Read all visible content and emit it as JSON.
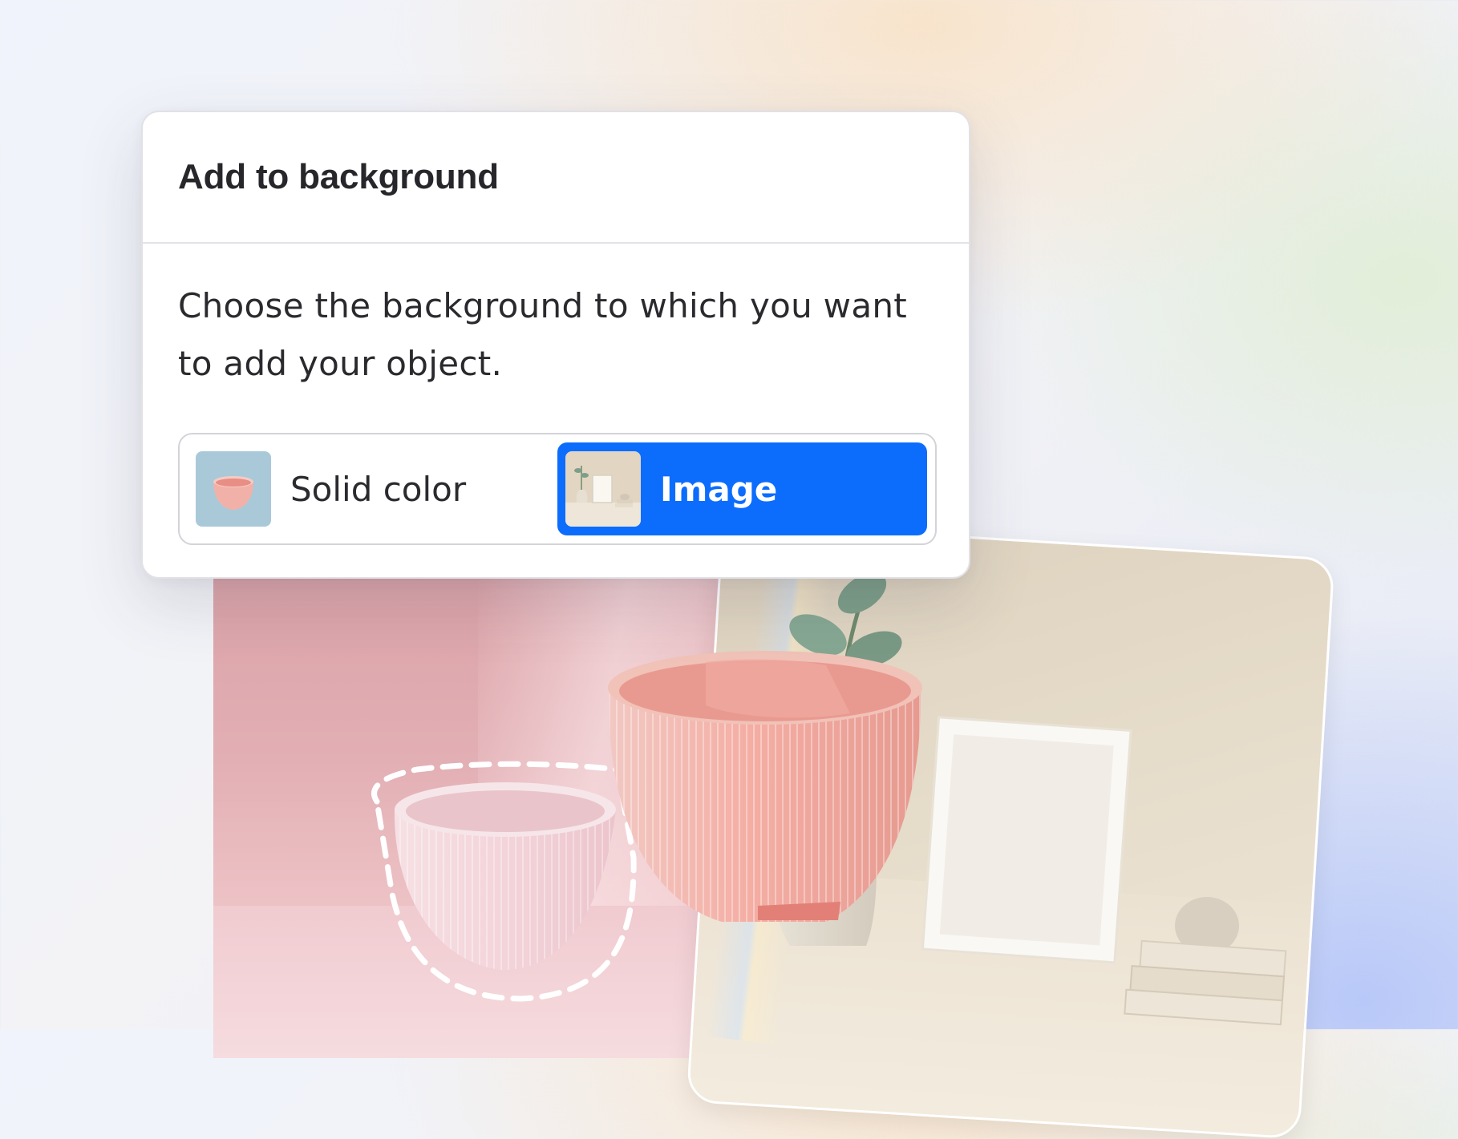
{
  "dialog": {
    "title": "Add to background",
    "description": "Choose the background to which you want to add your object.",
    "options": [
      {
        "label": "Solid color",
        "selected": false,
        "thumb": "bowl-on-blue-icon"
      },
      {
        "label": "Image",
        "selected": true,
        "thumb": "interior-scene-icon"
      }
    ]
  },
  "colors": {
    "accent": "#0c6dfd",
    "dialog_bg": "#ffffff",
    "title_text": "#27272b",
    "selection_outline": "#ffffff",
    "solid_color_thumb_bg": "#a9c9d9"
  },
  "scene": {
    "left_background": "pink-room",
    "right_background": "beige-room-with-frame-and-plant",
    "object": "pink-ribbed-bowl"
  }
}
